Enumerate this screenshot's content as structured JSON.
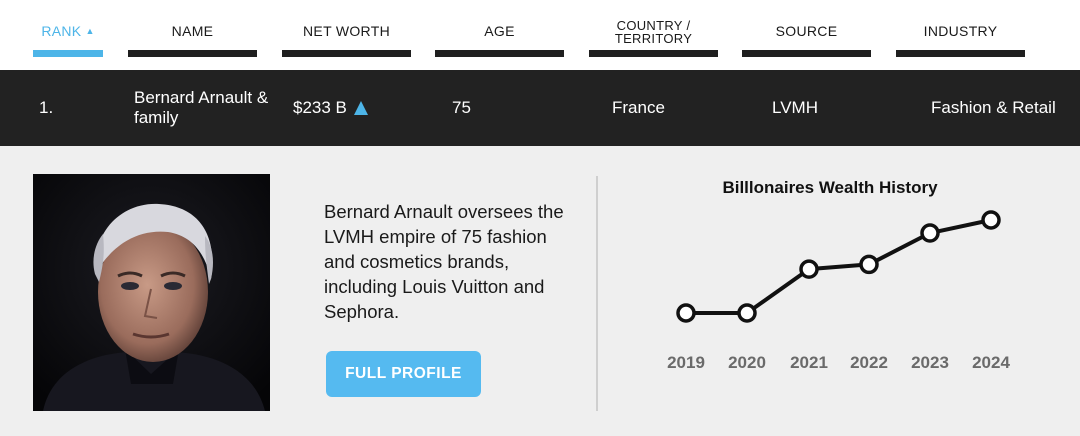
{
  "header": {
    "columns": [
      {
        "label": "RANK",
        "active": true
      },
      {
        "label": "NAME"
      },
      {
        "label": "NET WORTH"
      },
      {
        "label": "AGE"
      },
      {
        "label": "COUNTRY /\nTERRITORY"
      },
      {
        "label": "SOURCE"
      },
      {
        "label": "INDUSTRY"
      }
    ],
    "sort_icon": "chevron-up-icon",
    "active_color": "#4db5e8"
  },
  "row": {
    "rank": "1.",
    "name_line1": "Bernard Arnault &",
    "name_line2": "family",
    "net_worth": "$233 B",
    "trend_icon": "triangle-up-icon",
    "age": "75",
    "country": "France",
    "source": "LVMH",
    "industry": "Fashion & Retail"
  },
  "detail": {
    "bio": "Bernard Arnault oversees the LVMH empire of 75 fashion and cosmetics brands, including Louis Vuitton and Sephora.",
    "button_label": "FULL PROFILE",
    "button_color": "#55baf0"
  },
  "chart_data": {
    "type": "line",
    "title": "Billlonaires Wealth History",
    "categories": [
      "2019",
      "2020",
      "2021",
      "2022",
      "2023",
      "2024"
    ],
    "values": [
      76,
      76,
      150,
      158,
      211,
      233
    ],
    "xlabel": "",
    "ylabel": "",
    "grid": false,
    "y_axis_shown": false
  }
}
